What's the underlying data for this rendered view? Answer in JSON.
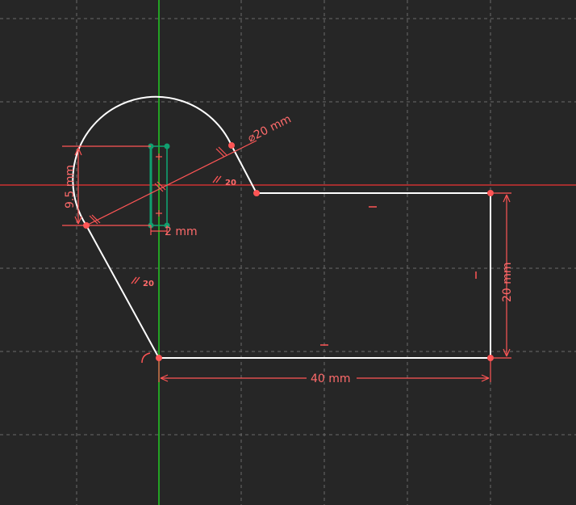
{
  "sketch": {
    "dimensions": {
      "width": "40 mm",
      "height": "20 mm",
      "arc_diameter": "⌀20 mm",
      "slot_height": "9.5 mm",
      "slot_width": "2 mm"
    },
    "constraints": {
      "parallel_upper": "20",
      "parallel_lower": "20"
    }
  },
  "colors": {
    "background": "#262626",
    "grid": "#6a6a6a",
    "geometry": "#ffffff",
    "constraint": "#ff5555",
    "vertical_axis": "#22cc22",
    "horizontal_axis": "#ee3333",
    "selected": "#10a070"
  }
}
